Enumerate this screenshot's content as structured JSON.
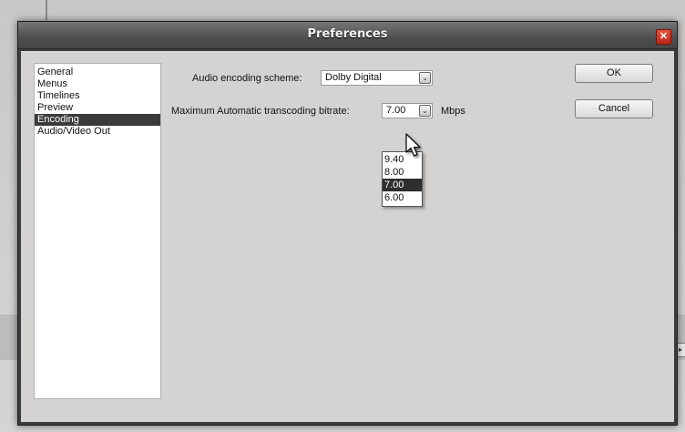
{
  "dialog": {
    "title": "Preferences",
    "close_glyph": "✕"
  },
  "categories": {
    "items": [
      {
        "label": "General",
        "selected": false
      },
      {
        "label": "Menus",
        "selected": false
      },
      {
        "label": "Timelines",
        "selected": false
      },
      {
        "label": "Preview",
        "selected": false
      },
      {
        "label": "Encoding",
        "selected": true
      },
      {
        "label": "Audio/Video Out",
        "selected": false
      }
    ]
  },
  "encoding": {
    "audio_label": "Audio encoding scheme:",
    "audio_value": "Dolby Digital",
    "bitrate_label": "Maximum Automatic transcoding bitrate:",
    "bitrate_value": "7.00",
    "bitrate_unit": "Mbps",
    "bitrate_options": [
      {
        "label": "9.40",
        "selected": false
      },
      {
        "label": "8.00",
        "selected": false
      },
      {
        "label": "7.00",
        "selected": true
      },
      {
        "label": "6.00",
        "selected": false
      }
    ]
  },
  "buttons": {
    "ok_label": "OK",
    "cancel_label": "Cancel"
  },
  "icons": {
    "dropdown_arrow": "⌄",
    "close": "close-icon",
    "cursor": "mouse-pointer-icon"
  },
  "colors": {
    "selection": "#3b3b3b",
    "titlebar": "#4e4e4e",
    "close": "#c7321f"
  }
}
